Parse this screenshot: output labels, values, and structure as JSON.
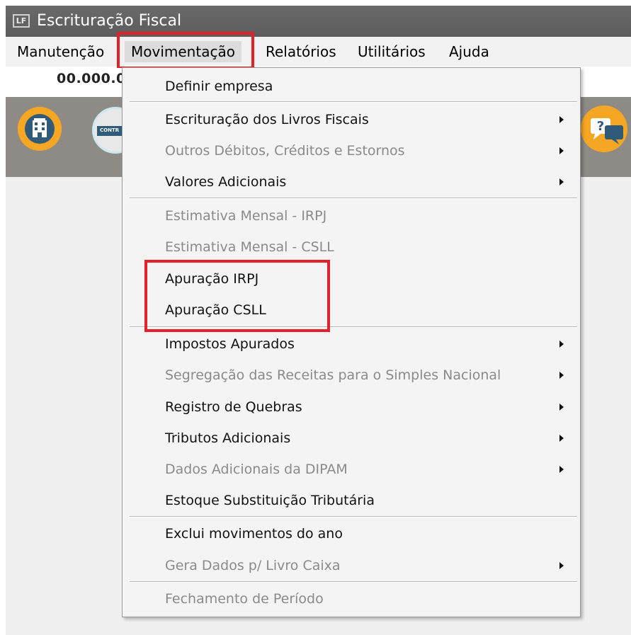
{
  "window": {
    "title": "Escrituração Fiscal",
    "app_icon_text": "LF"
  },
  "menubar": {
    "items": [
      {
        "label": "Manutenção"
      },
      {
        "label": "Movimentação"
      },
      {
        "label": "Relatórios"
      },
      {
        "label": "Utilitários"
      },
      {
        "label": "Ajuda"
      }
    ]
  },
  "strip": {
    "company_code": "00.000.0"
  },
  "toolbar": {
    "icons": [
      "building-icon",
      "controle-icon",
      "help-chat-icon"
    ],
    "controle_label": "CONTR"
  },
  "dropdown": {
    "items": [
      {
        "label": "Definir empresa",
        "enabled": true,
        "submenu": false
      },
      {
        "label": "Escrituração dos Livros Fiscais",
        "enabled": true,
        "submenu": true
      },
      {
        "label": "Outros Débitos, Créditos e Estornos",
        "enabled": false,
        "submenu": true
      },
      {
        "label": "Valores Adicionais",
        "enabled": true,
        "submenu": true
      },
      {
        "label": "Estimativa Mensal - IRPJ",
        "enabled": false,
        "submenu": false
      },
      {
        "label": "Estimativa Mensal - CSLL",
        "enabled": false,
        "submenu": false
      },
      {
        "label": "Apuração IRPJ",
        "enabled": true,
        "submenu": false
      },
      {
        "label": "Apuração CSLL",
        "enabled": true,
        "submenu": false
      },
      {
        "label": "Impostos Apurados",
        "enabled": true,
        "submenu": true
      },
      {
        "label": "Segregação das Receitas para o Simples Nacional",
        "enabled": false,
        "submenu": true
      },
      {
        "label": "Registro de Quebras",
        "enabled": true,
        "submenu": true
      },
      {
        "label": "Tributos Adicionais",
        "enabled": true,
        "submenu": true
      },
      {
        "label": "Dados Adicionais da DIPAM",
        "enabled": false,
        "submenu": true
      },
      {
        "label": "Estoque Substituição Tributária",
        "enabled": true,
        "submenu": false
      },
      {
        "label": "Exclui movimentos do ano",
        "enabled": true,
        "submenu": false
      },
      {
        "label": "Gera Dados p/ Livro Caixa",
        "enabled": false,
        "submenu": true
      },
      {
        "label": "Fechamento de Período",
        "enabled": false,
        "submenu": false
      }
    ]
  },
  "colors": {
    "highlight": "#e4202a",
    "toolbar": "#8e8a86",
    "titlebar": "#5c5c5c"
  }
}
